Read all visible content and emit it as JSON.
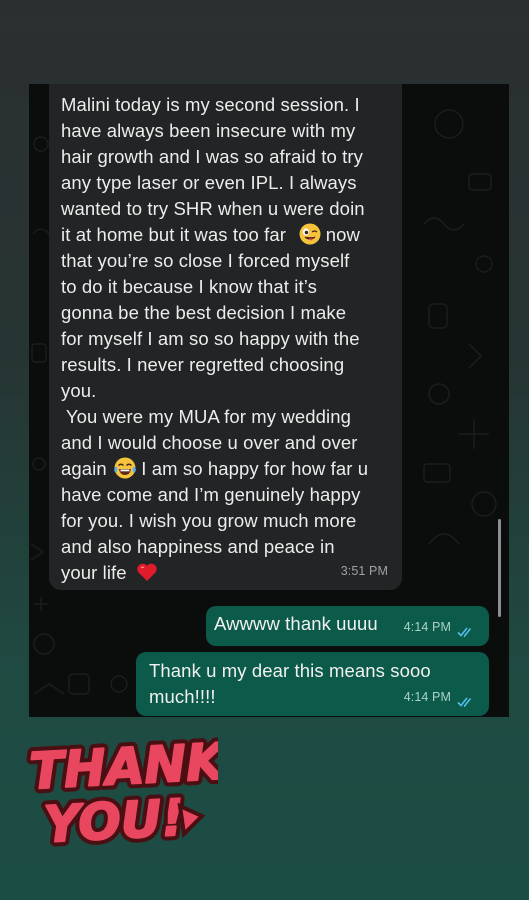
{
  "messages": {
    "incoming": {
      "lines": [
        "Malini today is my second session. I",
        "have always been insecure with my",
        "hair growth and I was so afraid to try",
        "any type laser or even IPL. I always",
        "wanted to try SHR when u were doin",
        "it at home but it was too far",
        "that you’re so close I forced myself",
        "to do it because I know that it’s",
        "gonna be the best decision I make",
        "for myself I am so so happy with the",
        "results. I never regretted choosing",
        "you.",
        " You were my MUA for my wedding",
        "and I would choose u over and over",
        "again",
        "have come and I’m genuinely happy",
        "for you. I wish you grow much more",
        "and also happiness and peace in",
        "your life"
      ],
      "line6_after_emoji": " now",
      "line15_after_emoji": " I am so happy for how far u",
      "time": "3:51 PM",
      "emoji_1": "winking-tongue-emoji",
      "emoji_2": "tears-of-joy-emoji",
      "emoji_3": "red-heart-emoji"
    },
    "outgoing": [
      {
        "text": "Awwww thank uuuu",
        "time": "4:14 PM",
        "status": "read"
      },
      {
        "text_lines": [
          "Thank u my dear this means sooo",
          "much!!!!"
        ],
        "time": "4:14 PM",
        "status": "read"
      }
    ]
  },
  "sticker": {
    "line1": "THANK",
    "line2": "YOU!",
    "color": "#e8475f"
  },
  "colors": {
    "incoming_bubble": "#222425",
    "outgoing_bubble": "#0c5a49",
    "read_ticks": "#53bdeb"
  }
}
